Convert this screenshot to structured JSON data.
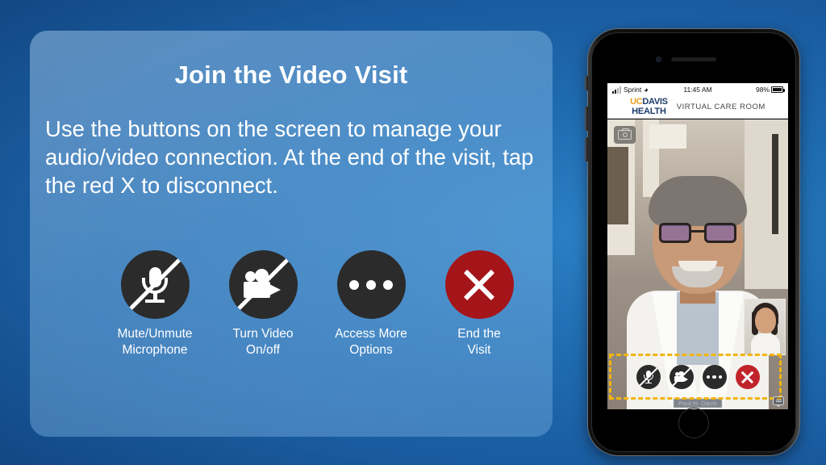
{
  "slide": {
    "title": "Join the Video Visit",
    "body": "Use the buttons on the screen to manage your audio/video connection. At the end of the visit, tap the red X to disconnect.",
    "accent_blue": "#1f6bb0",
    "card_tint": "#7fb2e0"
  },
  "buttons": [
    {
      "icon": "microphone-muted-icon",
      "label_line1": "Mute/Unmute",
      "label_line2": "Microphone",
      "color": "#2b2b2b"
    },
    {
      "icon": "video-camera-off-icon",
      "label_line1": "Turn Video",
      "label_line2": "On/off",
      "color": "#2b2b2b"
    },
    {
      "icon": "ellipsis-icon",
      "label_line1": "Access More",
      "label_line2": "Options",
      "color": "#2b2b2b"
    },
    {
      "icon": "close-x-icon",
      "label_line1": "End the",
      "label_line2": "Visit",
      "color": "#a4151a"
    }
  ],
  "phone": {
    "status_bar": {
      "carrier": "Sprint",
      "wifi_icon": "wifi-icon",
      "time": "11:45 AM",
      "battery_percent": "98%",
      "battery_icon": "battery-icon"
    },
    "app_header": {
      "brand_uc": "UC",
      "brand_davis": "DAVIS",
      "brand_health": "HEALTH",
      "room_title": "VIRTUAL CARE ROOM",
      "brand_gold": "#e8a01e",
      "brand_navy": "#1b3a6b"
    },
    "video": {
      "camera_flip_icon": "camera-icon",
      "self_view": "picture-in-picture-self-view",
      "name_plate": "Paul H. Davis",
      "chat_icon": "chat-bubble-icon"
    },
    "controls": [
      {
        "icon": "microphone-muted-icon",
        "color": "#2b2b2b"
      },
      {
        "icon": "video-camera-off-icon",
        "color": "#2b2b2b"
      },
      {
        "icon": "ellipsis-icon",
        "color": "#2b2b2b"
      },
      {
        "icon": "close-x-icon",
        "color": "#c0242a"
      }
    ],
    "highlight_color": "#f2b50c"
  }
}
